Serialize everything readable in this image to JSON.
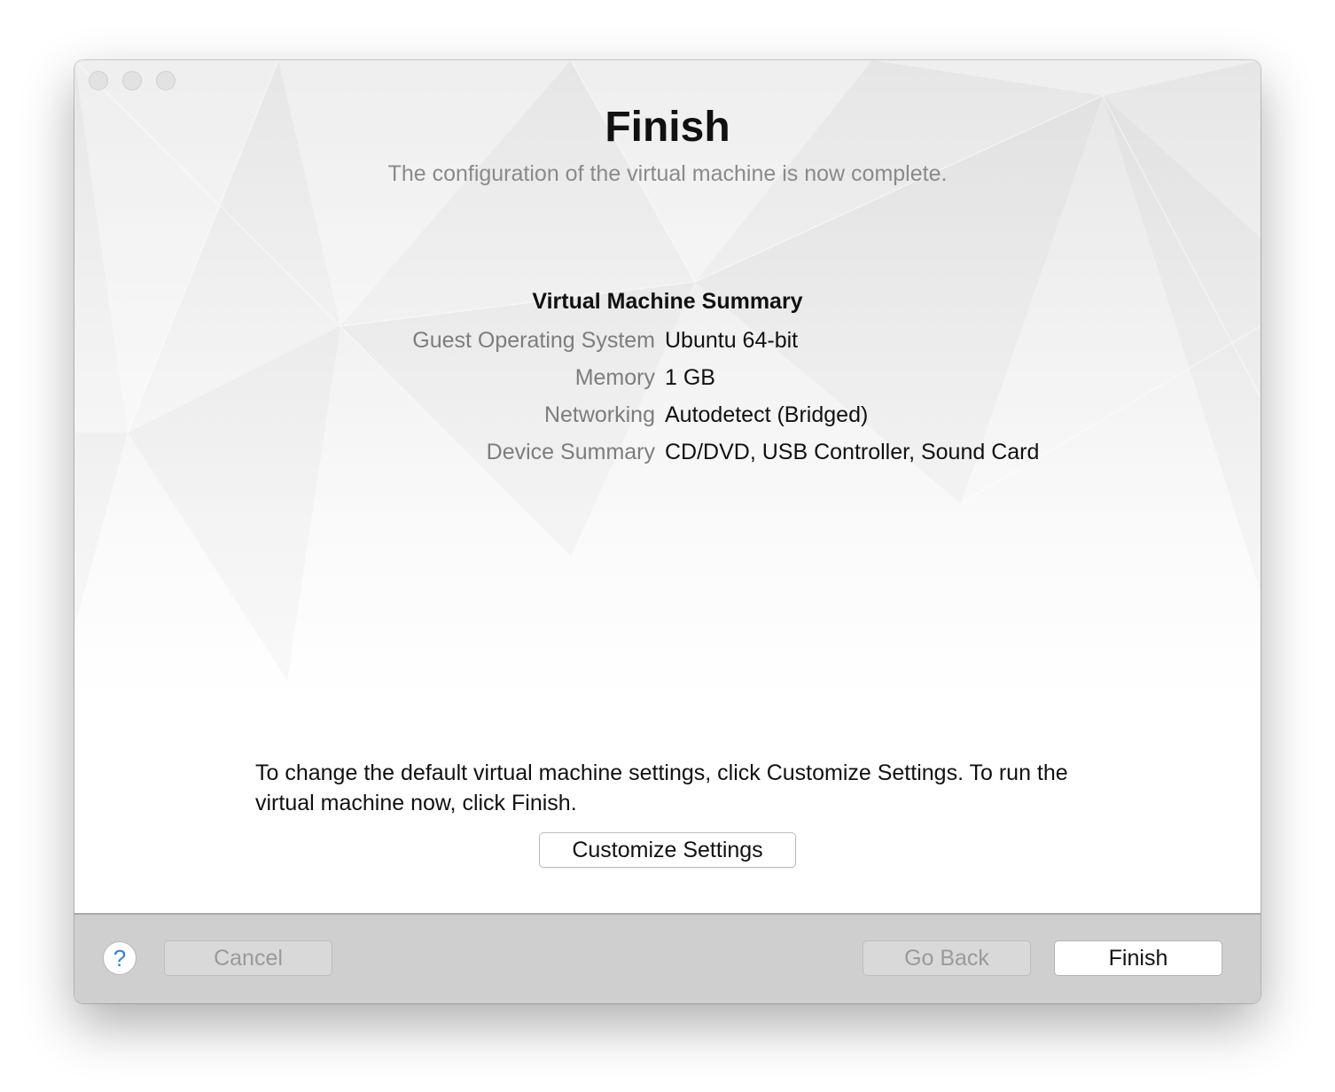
{
  "window": {
    "title": "Finish",
    "subtitle": "The configuration of the virtual machine is now complete."
  },
  "summary": {
    "title": "Virtual Machine Summary",
    "rows": [
      {
        "label": "Guest Operating System",
        "value": "Ubuntu 64-bit"
      },
      {
        "label": "Memory",
        "value": "1 GB"
      },
      {
        "label": "Networking",
        "value": "Autodetect (Bridged)"
      },
      {
        "label": "Device Summary",
        "value": "CD/DVD, USB Controller, Sound Card"
      }
    ]
  },
  "info": {
    "text": "To change the default virtual machine settings, click Customize Settings. To run the virtual machine now, click Finish.",
    "customize_label": "Customize Settings"
  },
  "footer": {
    "help_icon": "question-mark-icon",
    "help_glyph": "?",
    "cancel_label": "Cancel",
    "go_back_label": "Go Back",
    "finish_label": "Finish"
  },
  "colors": {
    "accent": "#2f7fe0",
    "footer_bg": "#cfcfcf",
    "label_gray": "#7d7d7d"
  }
}
